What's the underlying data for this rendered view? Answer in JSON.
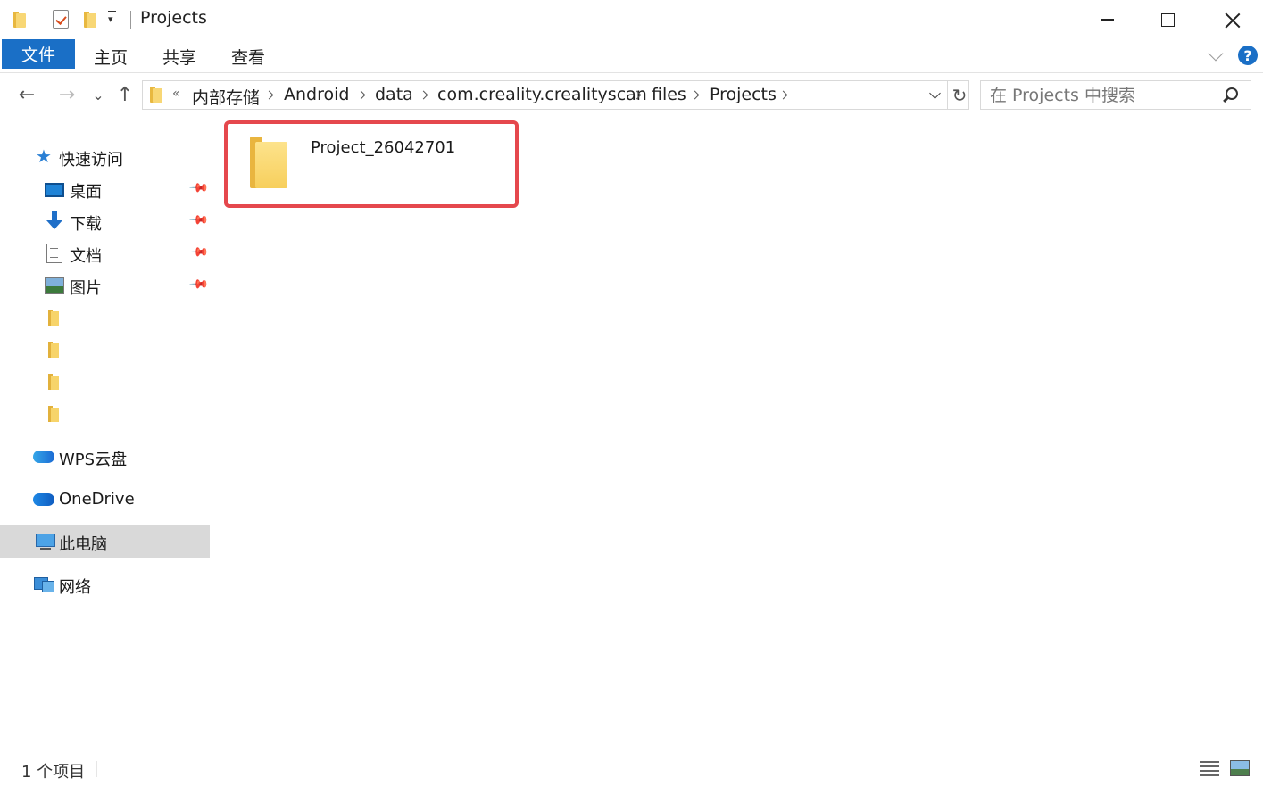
{
  "window": {
    "title": "Projects"
  },
  "ribbon": {
    "tabs": [
      {
        "label": "文件"
      },
      {
        "label": "主页"
      },
      {
        "label": "共享"
      },
      {
        "label": "查看"
      }
    ],
    "help": "?"
  },
  "nav": {
    "back": "←",
    "forward": "→",
    "recent": "⌄",
    "up": "↑"
  },
  "address": {
    "overflow": "«",
    "crumbs": [
      "内部存储",
      "Android",
      "data",
      "com.creality.crealityscan",
      "files",
      "Projects"
    ],
    "refresh": "↻"
  },
  "search": {
    "placeholder": "在 Projects 中搜索"
  },
  "sidebar": {
    "quick_access": "快速访问",
    "pinned": [
      {
        "label": "桌面",
        "icon": "desktop-icon"
      },
      {
        "label": "下载",
        "icon": "download-icon"
      },
      {
        "label": "文档",
        "icon": "documents-icon"
      },
      {
        "label": "图片",
        "icon": "pictures-icon"
      }
    ],
    "wps": "WPS云盘",
    "onedrive": "OneDrive",
    "this_pc": "此电脑",
    "network": "网络"
  },
  "content": {
    "items": [
      {
        "name": "Project_26042701"
      }
    ]
  },
  "status": {
    "count": "1 个项目"
  }
}
